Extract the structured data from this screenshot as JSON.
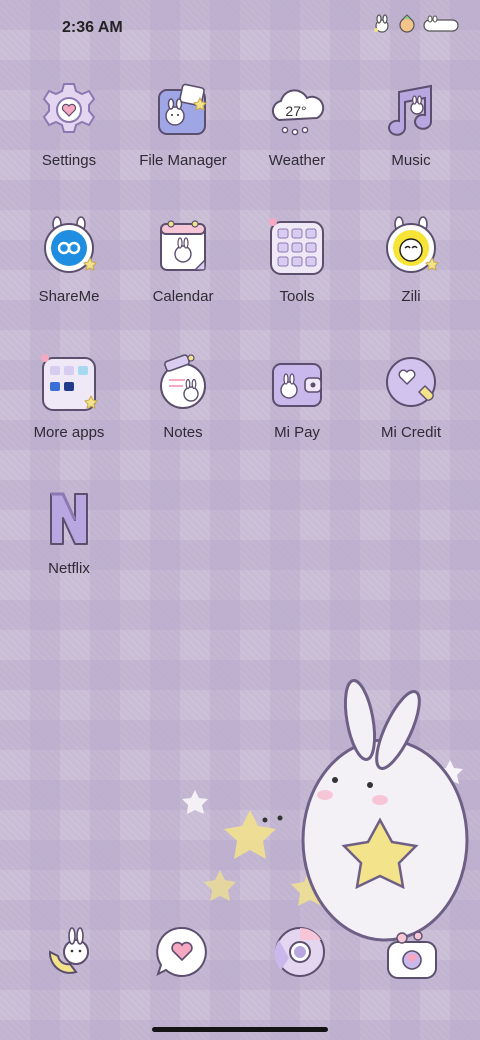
{
  "status_bar": {
    "time": "2:36 AM",
    "icons": [
      "bunny-status-icon",
      "carrot-status-icon",
      "bunny-sleeping-status-icon"
    ]
  },
  "apps": [
    {
      "label": "Settings",
      "icon": "gear-heart-icon"
    },
    {
      "label": "File Manager",
      "icon": "folder-bunny-icon"
    },
    {
      "label": "Weather",
      "icon": "cloud-icon",
      "temperature": "27°"
    },
    {
      "label": "Music",
      "icon": "music-note-bunny-icon"
    },
    {
      "label": "ShareMe",
      "icon": "shareme-bunny-icon"
    },
    {
      "label": "Calendar",
      "icon": "calendar-bunny-icon"
    },
    {
      "label": "Tools",
      "icon": "tools-folder-icon"
    },
    {
      "label": "Zili",
      "icon": "zili-bunny-icon"
    },
    {
      "label": "More apps",
      "icon": "more-apps-folder-icon"
    },
    {
      "label": "Notes",
      "icon": "notes-bunny-icon"
    },
    {
      "label": "Mi Pay",
      "icon": "wallet-bunny-icon"
    },
    {
      "label": "Mi Credit",
      "icon": "mi-credit-heart-icon"
    },
    {
      "label": "Netflix",
      "icon": "netflix-n-icon"
    }
  ],
  "dock": [
    {
      "icon": "phone-bunny-icon"
    },
    {
      "icon": "message-heart-icon"
    },
    {
      "icon": "chrome-icon"
    },
    {
      "icon": "camera-bunny-icon"
    }
  ],
  "colors": {
    "wallpaper": "#c9bdd6",
    "icon_lavender": "#b7a6e0",
    "icon_outline": "#5c4f6e",
    "star_yellow": "#f3e38a"
  }
}
